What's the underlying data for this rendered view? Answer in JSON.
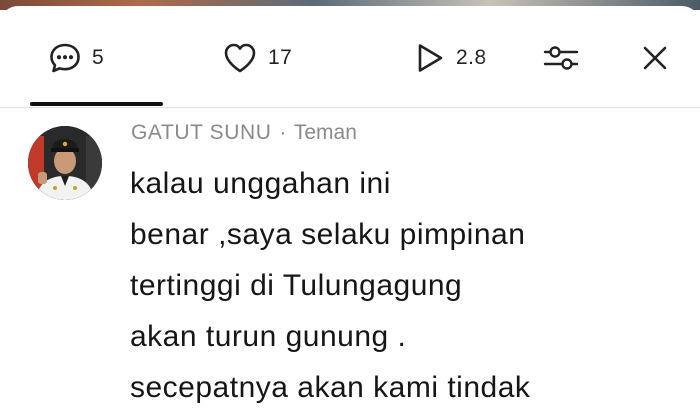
{
  "toolbar": {
    "comments_count": "5",
    "likes_count": "17",
    "views_count": "2.8",
    "icons": {
      "comments": "comment-bubble-icon",
      "likes": "heart-icon",
      "views": "play-icon",
      "filter": "sliders-icon",
      "close": "close-icon"
    }
  },
  "comment": {
    "author": "GATUT SUNU",
    "separator": "·",
    "relationship": "Teman",
    "lines": [
      "kalau unggahan ini",
      "benar ,saya selaku pimpinan",
      "tertinggi di Tulungagung",
      "akan turun gunung .",
      "secepatnya akan kami tindak"
    ]
  },
  "colors": {
    "text_primary": "#161616",
    "text_secondary": "#8a8a8a",
    "divider": "#e3e3e3",
    "tab_underline": "#111111"
  }
}
